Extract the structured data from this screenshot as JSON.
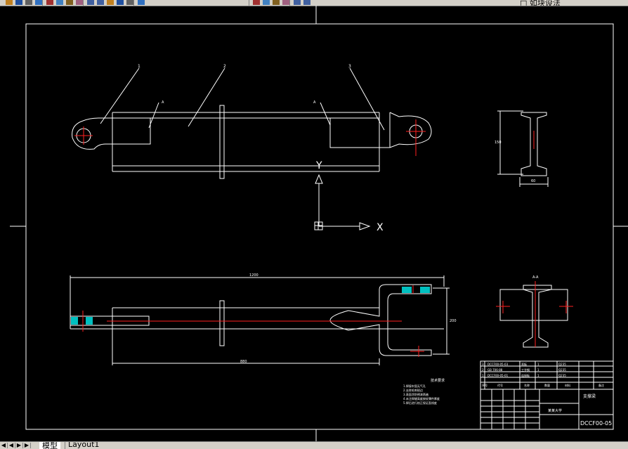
{
  "toolbar": {
    "icons": [
      "open-icon",
      "save-icon",
      "print-icon",
      "preview-icon",
      "cut-icon",
      "copy-icon",
      "paste-icon",
      "match-icon",
      "undo-icon",
      "redo-icon",
      "pan-icon",
      "zoom-realtime-icon",
      "zoom-window-icon",
      "zoom-previous-icon",
      "text-icon",
      "table-icon",
      "properties-icon",
      "design-center-icon",
      "layer-icon",
      "layer-state-icon"
    ],
    "hint_text": "□ 如块设法"
  },
  "drawing": {
    "leader_labels": [
      "1",
      "2",
      "3"
    ],
    "tag_a": "A",
    "tag_b": "A",
    "section_label": "A-A",
    "ucs_x": "X",
    "ucs_y": "Y",
    "dim_top_length": "1200",
    "dim_bottom_length": "880",
    "dim_right_height": "200",
    "dim_side_width": "60",
    "dim_side_height": "150",
    "notes_title": "技术要求",
    "notes": [
      "1.焊接牢固无气孔",
      "2.去除毛刺锐边",
      "3.表面涂防锈漆两遍",
      "4.未注焊缝高度按较薄件厚度",
      "5.焊后进行校正保证直线度"
    ],
    "title_block": {
      "parts": [
        [
          "3",
          "DCCF00-05-03",
          "耳板",
          "1",
          "Q235"
        ],
        [
          "2",
          "GB 706-88",
          "工字钢",
          "1",
          "Q235"
        ],
        [
          "1",
          "DCCF00-05-01",
          "连接板",
          "1",
          "Q235"
        ]
      ],
      "header": [
        "序号",
        "代号",
        "名称",
        "数量",
        "材料",
        "备注"
      ],
      "drawing_name": "支撑梁",
      "company": "某某大学",
      "drawing_number": "DCCF00-05"
    }
  },
  "tabs": {
    "model": "模型",
    "layout1": "Layout1"
  }
}
